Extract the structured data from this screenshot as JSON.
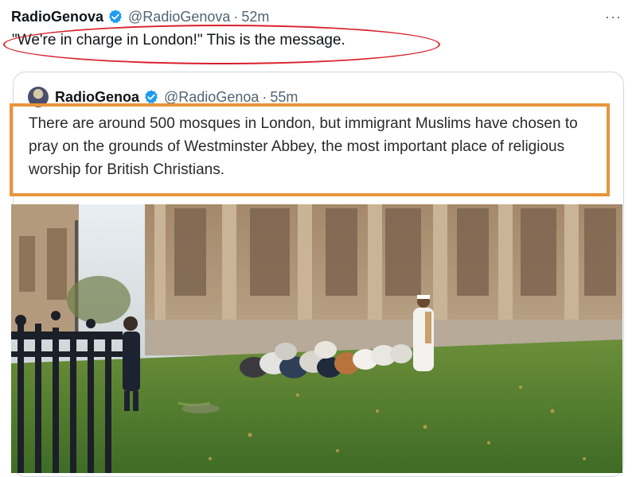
{
  "tweet": {
    "display_name": "RadioGenova",
    "handle": "@RadioGenova",
    "separator": "·",
    "time": "52m",
    "more_label": "···",
    "text": "\"We're in charge in London!\" This is the message."
  },
  "quote": {
    "display_name": "RadioGenoa",
    "handle": "@RadioGenoa",
    "separator": "·",
    "time": "55m",
    "text": "There are around 500 mosques in London, but immigrant Muslims have chosen to pray on the grounds of Westminster Abbey, the most important place of religious worship for British Christians."
  },
  "colors": {
    "verified": "#1d9bf0",
    "red_highlight": "#d9202a",
    "orange_highlight": "#e8953a",
    "grass": "#4f7a2c",
    "stone": "#a88c6a"
  },
  "icons": {
    "verified": "verified-badge-icon",
    "more": "more-options-icon",
    "avatar": "profile-avatar"
  },
  "photo": {
    "subject": "Group praying on grass beside Westminster Abbey"
  }
}
